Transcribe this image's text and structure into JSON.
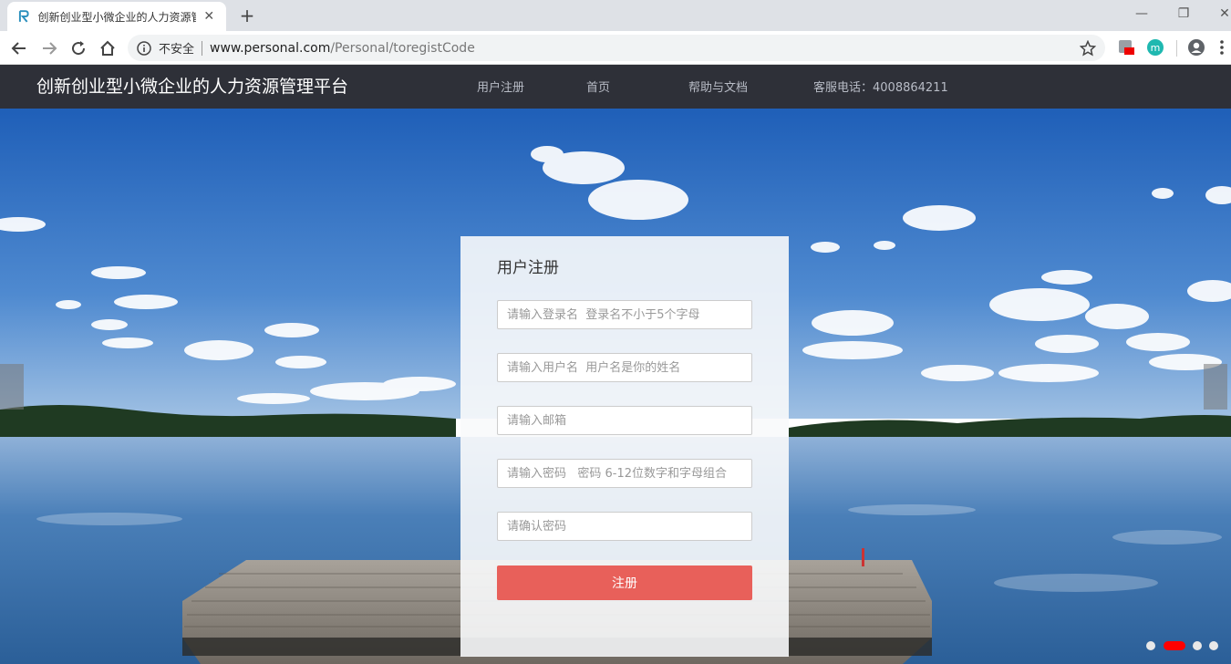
{
  "browser": {
    "tab_title": "创新创业型小微企业的人力资源管理平台",
    "omnibox": {
      "security_label": "不安全",
      "host": "www.personal.com",
      "path": "/Personal/toregistCode"
    },
    "icons": [
      "back-icon",
      "forward-icon",
      "reload-icon",
      "home-icon",
      "info-icon",
      "star-icon",
      "extension-icon",
      "profile-icon",
      "menu-icon"
    ]
  },
  "site": {
    "title": "创新创业型小微企业的人力资源管理平台",
    "nav": {
      "register": "用户注册",
      "home": "首页",
      "help": "帮助与文档",
      "service_phone": "客服电话：4008864211"
    }
  },
  "form": {
    "title": "用户注册",
    "login_name_placeholder": "请输入登录名  登录名不小于5个字母",
    "user_name_placeholder": "请输入用户名  用户名是你的姓名",
    "email_placeholder": "请输入邮箱",
    "password_placeholder": "请输入密码   密码 6-12位数字和字母组合",
    "confirm_password_placeholder": "请确认密码",
    "submit_label": "注册"
  },
  "carousel": {
    "slide_count": 4,
    "active_index": 1,
    "active_color": "#ff0000"
  },
  "colors": {
    "header_bg": "#2e3038",
    "submit_bg": "#e8605a",
    "sky": "#2f6fc4",
    "water": "#4a7fb8"
  }
}
